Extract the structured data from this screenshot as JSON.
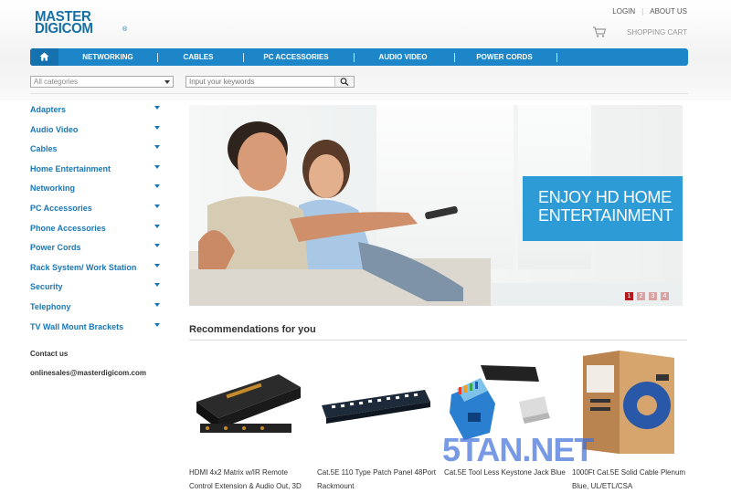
{
  "header": {
    "logo_line1": "MASTER",
    "logo_line2": "DIGICOM",
    "logo_reg": "®",
    "login": "LOGIN",
    "about": "ABOUT US",
    "cart": "SHOPPING CART",
    "cart_icon": "shopping-cart-icon"
  },
  "nav": {
    "home_icon": "home-icon",
    "items": [
      "NETWORKING",
      "CABLES",
      "PC ACCESSORIES",
      "AUDIO VIDEO",
      "POWER CORDS"
    ]
  },
  "search": {
    "category": "All categories",
    "placeholder": "Input your keywords",
    "icon": "search-icon"
  },
  "sidebar": {
    "items": [
      "Adapters",
      "Audio Video",
      "Cables",
      "Home Entertainment",
      "Networking",
      "PC Accessories",
      "Phone Accessories",
      "Power Cords",
      "Rack System/ Work Station",
      "Security",
      "Telephony",
      "TV Wall Mount Brackets"
    ],
    "contact_heading": "Contact us",
    "contact_email": "onlinesales@masterdigicom.com"
  },
  "banner": {
    "caption_line1": "ENJOY HD HOME",
    "caption_line2": "ENTERTAINMENT",
    "pages": [
      "1",
      "2",
      "3",
      "4"
    ],
    "active_page": "1"
  },
  "recommendations": {
    "title": "Recommendations for you",
    "products": [
      {
        "title": "HDMI 4x2 Matrix w/IR Remote Control Extension & Audio Out, 3D"
      },
      {
        "title": "Cat.5E 110 Type Patch Panel 48Port Rackmount"
      },
      {
        "title": "Cat.5E Tool Less Keystone Jack Blue"
      },
      {
        "title": "1000Ft Cat.5E Solid Cable Plenum Blue, UL/ETL/CSA"
      }
    ]
  },
  "watermark": "5TAN.NET",
  "colors": {
    "brand": "#1670a6",
    "nav": "#1d86c9",
    "caption": "#2c9bd6",
    "link": "#1a77b5"
  }
}
